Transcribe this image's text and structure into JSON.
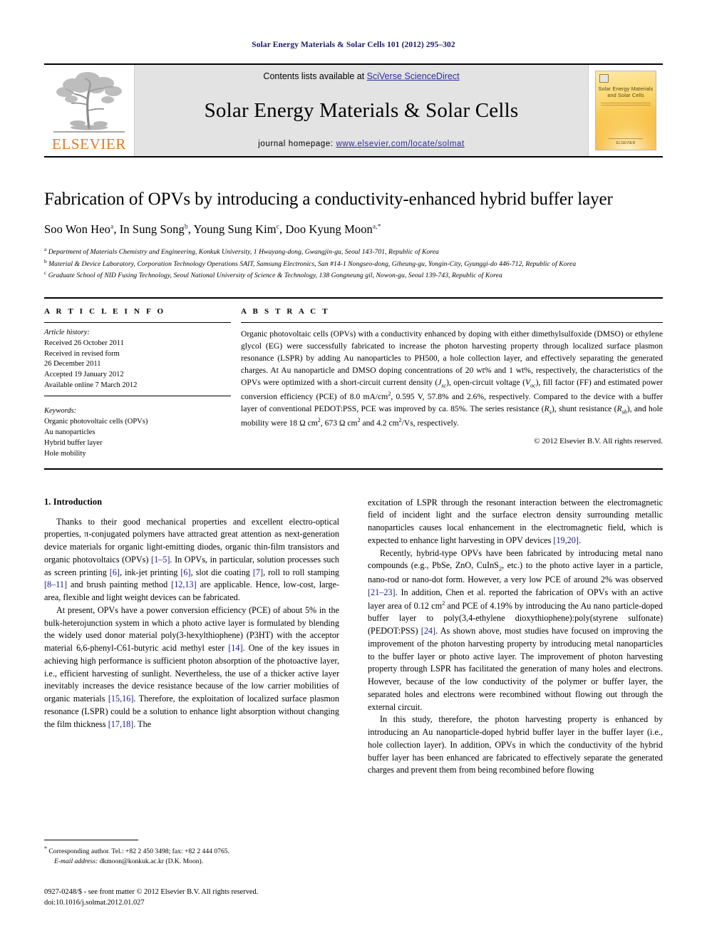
{
  "running_head": "Solar Energy Materials & Solar Cells 101 (2012) 295–302",
  "masthead": {
    "publisher_wordmark": "ELSEVIER",
    "contents_prefix": "Contents lists available at ",
    "contents_link": "SciVerse ScienceDirect",
    "journal_title": "Solar Energy Materials & Solar Cells",
    "homepage_prefix": "journal homepage: ",
    "homepage_url": "www.elsevier.com/locate/solmat",
    "cover": {
      "title_line1": "Solar Energy Materials",
      "title_line2": "and Solar Cells",
      "footer": "ELSEVIER"
    }
  },
  "article": {
    "title": "Fabrication of OPVs by introducing a conductivity-enhanced hybrid buffer layer",
    "authors": [
      {
        "name": "Soo Won Heo",
        "sup": "a",
        "sep": ", "
      },
      {
        "name": "In Sung Song",
        "sup": "b",
        "sep": ", "
      },
      {
        "name": "Young Sung Kim",
        "sup": "c",
        "sep": ", "
      },
      {
        "name": "Doo Kyung Moon",
        "sup": "a,*",
        "sep": ""
      }
    ],
    "affiliations": [
      {
        "marker": "a",
        "text": "Department of Materials Chemistry and Engineering, Konkuk University, 1 Hwayang-dong, Gwangjin-gu, Seoul 143-701, Republic of Korea"
      },
      {
        "marker": "b",
        "text": "Material & Device Laboratory, Corporation Technology Operations SAIT, Samsung Electronics, San #14-1 Nongseo-dong, Giheung-gu, Yongin-City, Gyunggi-do 446-712, Republic of Korea"
      },
      {
        "marker": "c",
        "text": "Graduate School of NID Fusing Technology, Seoul National University of Science & Technology, 138 Gongneung gil, Nowon-gu, Seoul 139-743, Republic of Korea"
      }
    ]
  },
  "article_info": {
    "heading": "A R T I C L E   I N F O",
    "history_label": "Article history:",
    "history": [
      "Received 26 October 2011",
      "Received in revised form",
      "26 December 2011",
      "Accepted 19 January 2012",
      "Available online 7 March 2012"
    ],
    "keywords_label": "Keywords:",
    "keywords": [
      "Organic photovoltaic cells (OPVs)",
      "Au nanoparticles",
      "Hybrid buffer layer",
      "Hole mobility"
    ]
  },
  "abstract": {
    "heading": "A B S T R A C T",
    "copyright": "© 2012 Elsevier B.V. All rights reserved."
  },
  "intro": {
    "heading": "1.  Introduction"
  },
  "footnote": {
    "corresponding": "Corresponding author. Tel.: +82 2 450 3498; fax: +82 2 444 0765.",
    "email_label": "E-mail address:",
    "email": "dkmoon@konkuk.ac.kr (D.K. Moon).",
    "star": "*"
  },
  "imprint": {
    "line1": "0927-0248/$ - see front matter © 2012 Elsevier B.V. All rights reserved.",
    "line2": "doi:10.1016/j.solmat.2012.01.027"
  },
  "colors": {
    "running_head": "#1a1a6e",
    "link": "#2b2b9e",
    "reference": "#1a1a8c",
    "elsevier_orange": "#E87722",
    "banner_gray": "#e3e3e3"
  }
}
